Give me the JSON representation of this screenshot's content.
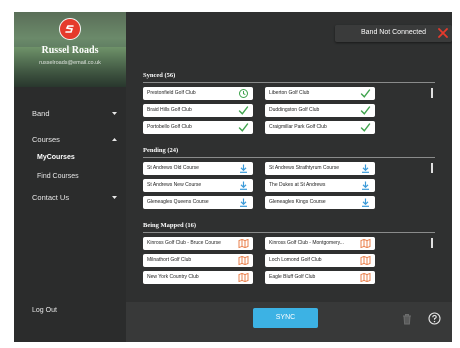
{
  "user": {
    "name": "Russel Roads",
    "email": "russelroads@email.co.uk"
  },
  "nav": {
    "band": "Band",
    "courses": "Courses",
    "my_courses": "MyCourses",
    "find_courses": "Find Courses",
    "contact_us": "Contact Us",
    "log_out": "Log Out"
  },
  "band_status": "Band Not Connected",
  "sections": {
    "synced": {
      "title": "Synced (56)",
      "courses": [
        "Prestonfield Golf Club",
        "Liberton Golf Club",
        "Braid Hills Golf Club",
        "Duddingston Golf Club",
        "Portobello Golf Club",
        "Craigmillar Park Golf Club"
      ],
      "icons": [
        "pending-sync-icon",
        "check-icon",
        "check-icon",
        "check-icon",
        "check-icon",
        "check-icon"
      ]
    },
    "pending": {
      "title": "Pending (24)",
      "courses": [
        "St Andrews Old Course",
        "St Andrews Strathtyrum Course",
        "St Andrews New Course",
        "The Dukes at St Andrews",
        "Gleneagles Queens Course",
        "Gleneagles Kings Course"
      ],
      "icons": [
        "download-icon",
        "download-icon",
        "download-icon",
        "download-icon",
        "download-icon",
        "download-icon"
      ]
    },
    "mapped": {
      "title": "Being Mapped (16)",
      "courses": [
        "Kinross Golf Club - Bruce Course",
        "Kinross Golf Club - Montgomery...",
        "Milnathort Golf Club",
        "Loch Lomond Golf Club",
        "New York Country Club",
        "Eagle Bluff Golf Club"
      ],
      "icons": [
        "map-icon",
        "map-icon",
        "map-icon",
        "map-icon",
        "map-icon",
        "map-icon"
      ]
    }
  },
  "footer": {
    "sync_label": "SYNC"
  },
  "colors": {
    "accent": "#3cb2e4",
    "check": "#3fa34d",
    "download": "#3a9ad9",
    "map": "#e8743b",
    "error": "#e53a2c"
  }
}
